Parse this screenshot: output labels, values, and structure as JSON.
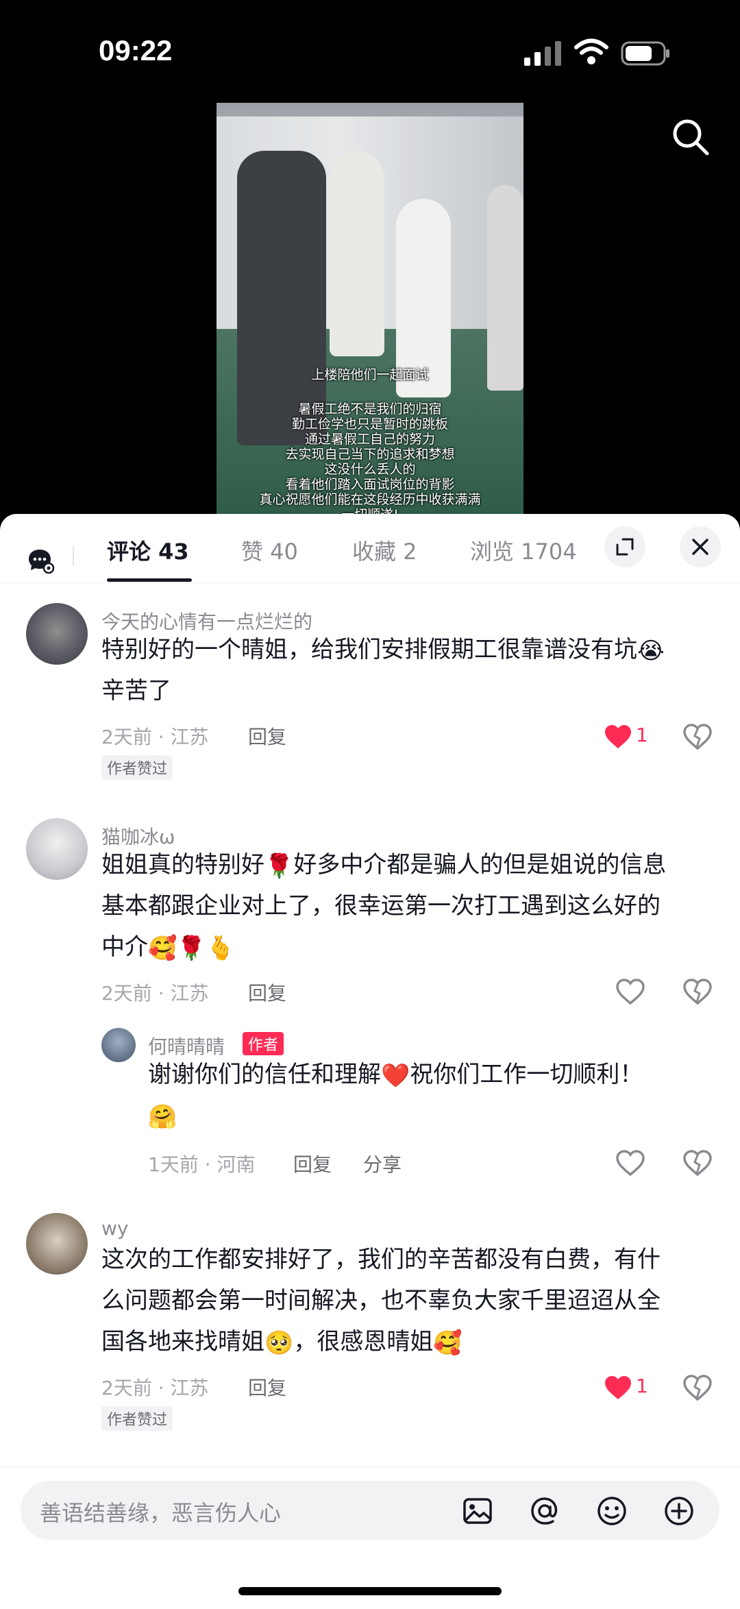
{
  "status_bar": {
    "time": "09:22"
  },
  "video": {
    "caption_title": "上楼陪他们一起面试",
    "caption_lines": [
      "暑假工绝不是我们的归宿",
      "勤工俭学也只是暂时的跳板",
      "通过暑假工自己的努力",
      "去实现自己当下的追求和梦想",
      "这没什么丢人的",
      "看着他们踏入面试岗位的背影",
      "真心祝愿他们能在这段经历中收获满满",
      "一切顺遂!"
    ]
  },
  "tabs": [
    {
      "label": "评论 43",
      "active": true
    },
    {
      "label": "赞 40",
      "active": false
    },
    {
      "label": "收藏 2",
      "active": false
    },
    {
      "label": "浏览 1704",
      "active": false
    }
  ],
  "comments": [
    {
      "username": "今天的心情有一点烂烂的",
      "text_line1": "特别好的一个晴姐，给我们安排假期工很靠谱没有坑",
      "text_line1_emoji": "😭",
      "text_line2": "辛苦了",
      "meta": "2天前 · 江苏",
      "reply_label": "回复",
      "like_count": "1",
      "author_liked_badge": "作者赞过"
    },
    {
      "username": "猫咖冰ω",
      "text_a": "姐姐真的特别好",
      "emoji_rose": "🌹",
      "text_b": "好多中介都是骗人的但是姐说的信息",
      "text_line2": "基本都跟企业对上了，很幸运第一次打工遇到这么好的",
      "text_line3": "中介",
      "emoji_hug": "🥰",
      "emoji_heart_hand": "🫰",
      "meta": "2天前 · 江苏",
      "reply_label": "回复",
      "reply": {
        "username": "何晴晴晴",
        "author_tag": "作者",
        "text_a": "谢谢你们的信任和理解",
        "emoji_heart": "❤️",
        "text_b": "祝你们工作一切顺利！",
        "emoji_line2": "🤗",
        "meta": "1天前 · 河南",
        "reply_label": "回复",
        "share_label": "分享"
      }
    },
    {
      "username": "wy",
      "text_line1": "这次的工作都安排好了，我们的辛苦都没有白费，有什",
      "text_line2": "么问题都会第一时间解决，也不辜负大家千里迢迢从全",
      "text_line3a": "国各地来找晴姐",
      "emoji_a": "🥺",
      "text_line3b": "，很感恩晴姐",
      "emoji_b": "🥰",
      "meta": "2天前 · 江苏",
      "reply_label": "回复",
      "like_count": "1",
      "author_liked_badge": "作者赞过"
    }
  ],
  "input": {
    "placeholder": "善语结善缘，恶言伤人心"
  },
  "icons": [
    "search-icon",
    "comment-settings-icon",
    "expand-icon",
    "close-icon",
    "heart-icon",
    "dislike-heart-icon",
    "image-icon",
    "at-icon",
    "emoji-icon",
    "plus-icon"
  ],
  "colors": {
    "accent": "#fe2c55",
    "text": "#161823",
    "muted": "#8a8b91"
  }
}
